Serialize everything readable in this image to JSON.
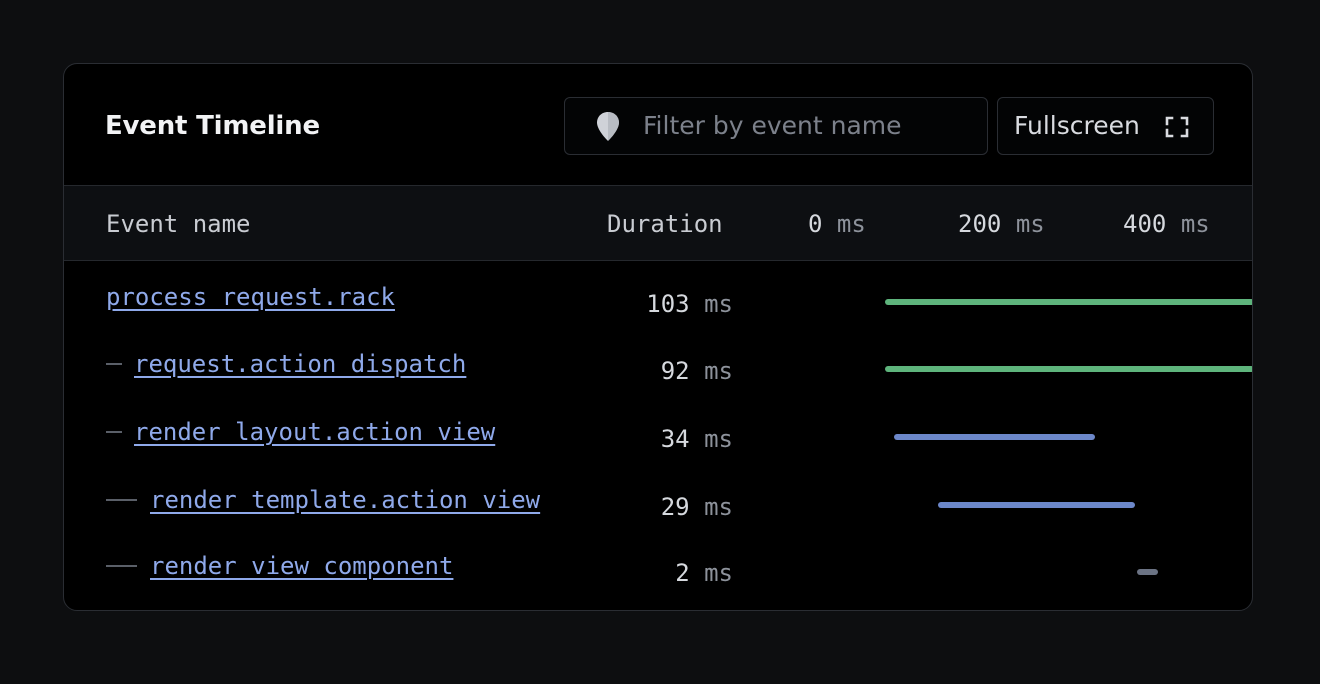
{
  "panel": {
    "title": "Event Timeline",
    "filter": {
      "placeholder": "Filter by event name",
      "value": "",
      "icon": "map-pin-icon"
    },
    "fullscreen": {
      "label": "Fullscreen",
      "icon": "expand-corners-icon"
    }
  },
  "columns": {
    "event_name": "Event name",
    "duration": "Duration",
    "timeline_ticks": [
      {
        "value": "0",
        "unit": "ms"
      },
      {
        "value": "200",
        "unit": "ms"
      },
      {
        "value": "400",
        "unit": "ms"
      }
    ]
  },
  "events": [
    {
      "name": "process_request.rack",
      "depth": 0,
      "duration": "103",
      "unit": "ms",
      "bar_color": "#5eb47c"
    },
    {
      "name": "request.action_dispatch",
      "depth": 1,
      "duration": "92",
      "unit": "ms",
      "bar_color": "#5eb47c"
    },
    {
      "name": "render_layout.action_view",
      "depth": 1,
      "duration": "34",
      "unit": "ms",
      "bar_color": "#6c87c9"
    },
    {
      "name": "render_template.action_view",
      "depth": 2,
      "duration": "29",
      "unit": "ms",
      "bar_color": "#6c87c9"
    },
    {
      "name": "render_view_component",
      "depth": 2,
      "duration": "2",
      "unit": "ms",
      "bar_color": "#6b7384"
    }
  ],
  "colors": {
    "background": "#0d0e10",
    "panel": "#000000",
    "link": "#8fa9ea",
    "bar_green": "#5eb47c",
    "bar_blue": "#6c87c9",
    "bar_gray": "#6b7384"
  }
}
